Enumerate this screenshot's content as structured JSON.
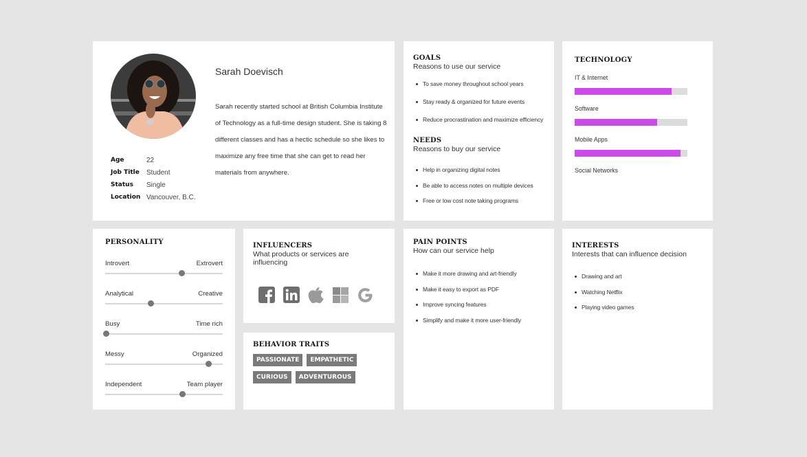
{
  "profile": {
    "name": "Sarah Doevisch",
    "avatar_alt": "Photo of Sarah Doevisch",
    "bio": "Sarah recently started school at British Columbia Institute of Technology as a full-time design student.  She is taking 8 different classes and  has a hectic schedule so she likes to maximize any free time that she can get to read her materials from anywhere.",
    "facts": [
      {
        "label": "Age",
        "value": "22"
      },
      {
        "label": "Job Title",
        "value": "Student"
      },
      {
        "label": "Status",
        "value": "Single"
      },
      {
        "label": "Location",
        "value": "Vancouver, B.C."
      }
    ]
  },
  "goals": {
    "title": "GOALS",
    "subtitle": "Reasons to use our service",
    "items": [
      "To save money throughout school years",
      "Stay ready & organized for future events",
      "Reduce procrastination and maximize efficiency"
    ]
  },
  "needs": {
    "title": "NEEDS",
    "subtitle": "Reasons to buy our service",
    "items": [
      "Help in organizing digital notes",
      "Be able to access notes on multiple devices",
      "Free or low cost note taking programs"
    ]
  },
  "technology": {
    "title": "TECHNOLOGY",
    "bar_color": "#cc4ae8",
    "track_color": "#dcdcdc",
    "items": [
      {
        "label": "IT & Internet",
        "level": 0.86
      },
      {
        "label": "Software",
        "level": 0.73
      },
      {
        "label": "Mobile Apps",
        "level": 0.94
      },
      {
        "label": "Social  Networks",
        "level": null
      }
    ]
  },
  "personality": {
    "title": "PERSONALITY",
    "traits": [
      {
        "left": "Introvert",
        "right": "Extrovert",
        "value": 0.65
      },
      {
        "left": "Analytical",
        "right": "Creative",
        "value": 0.39
      },
      {
        "left": "Busy",
        "right": "Time rich",
        "value": 0.01
      },
      {
        "left": "Messy",
        "right": "Organized",
        "value": 0.88
      },
      {
        "left": "Independent",
        "right": "Team player",
        "value": 0.66
      }
    ]
  },
  "influencers": {
    "title": "INFLUENCERS",
    "subtitle": "What products or services are influencing",
    "brands": [
      "facebook-icon",
      "linkedin-icon",
      "apple-icon",
      "microsoft-icon",
      "google-icon"
    ]
  },
  "behavior": {
    "title": "BEHAVIOR TRAITS",
    "tags": [
      [
        "PASSIONATE",
        "EMPATHETIC"
      ],
      [
        "CURIOUS",
        "ADVENTUROUS"
      ]
    ]
  },
  "pain_points": {
    "title": "PAIN POINTS",
    "subtitle": "How can our service help",
    "items": [
      "Make it more drawing and art-friendly",
      "Make it easy to export as PDF",
      "Improve syncing features",
      "Simplify and make it more user-friendly"
    ]
  },
  "interests": {
    "title": "INTERESTS",
    "subtitle": "Interests that can influence decision",
    "items": [
      "Drawing and art",
      "Watching Netflix",
      "Playing video games"
    ]
  }
}
